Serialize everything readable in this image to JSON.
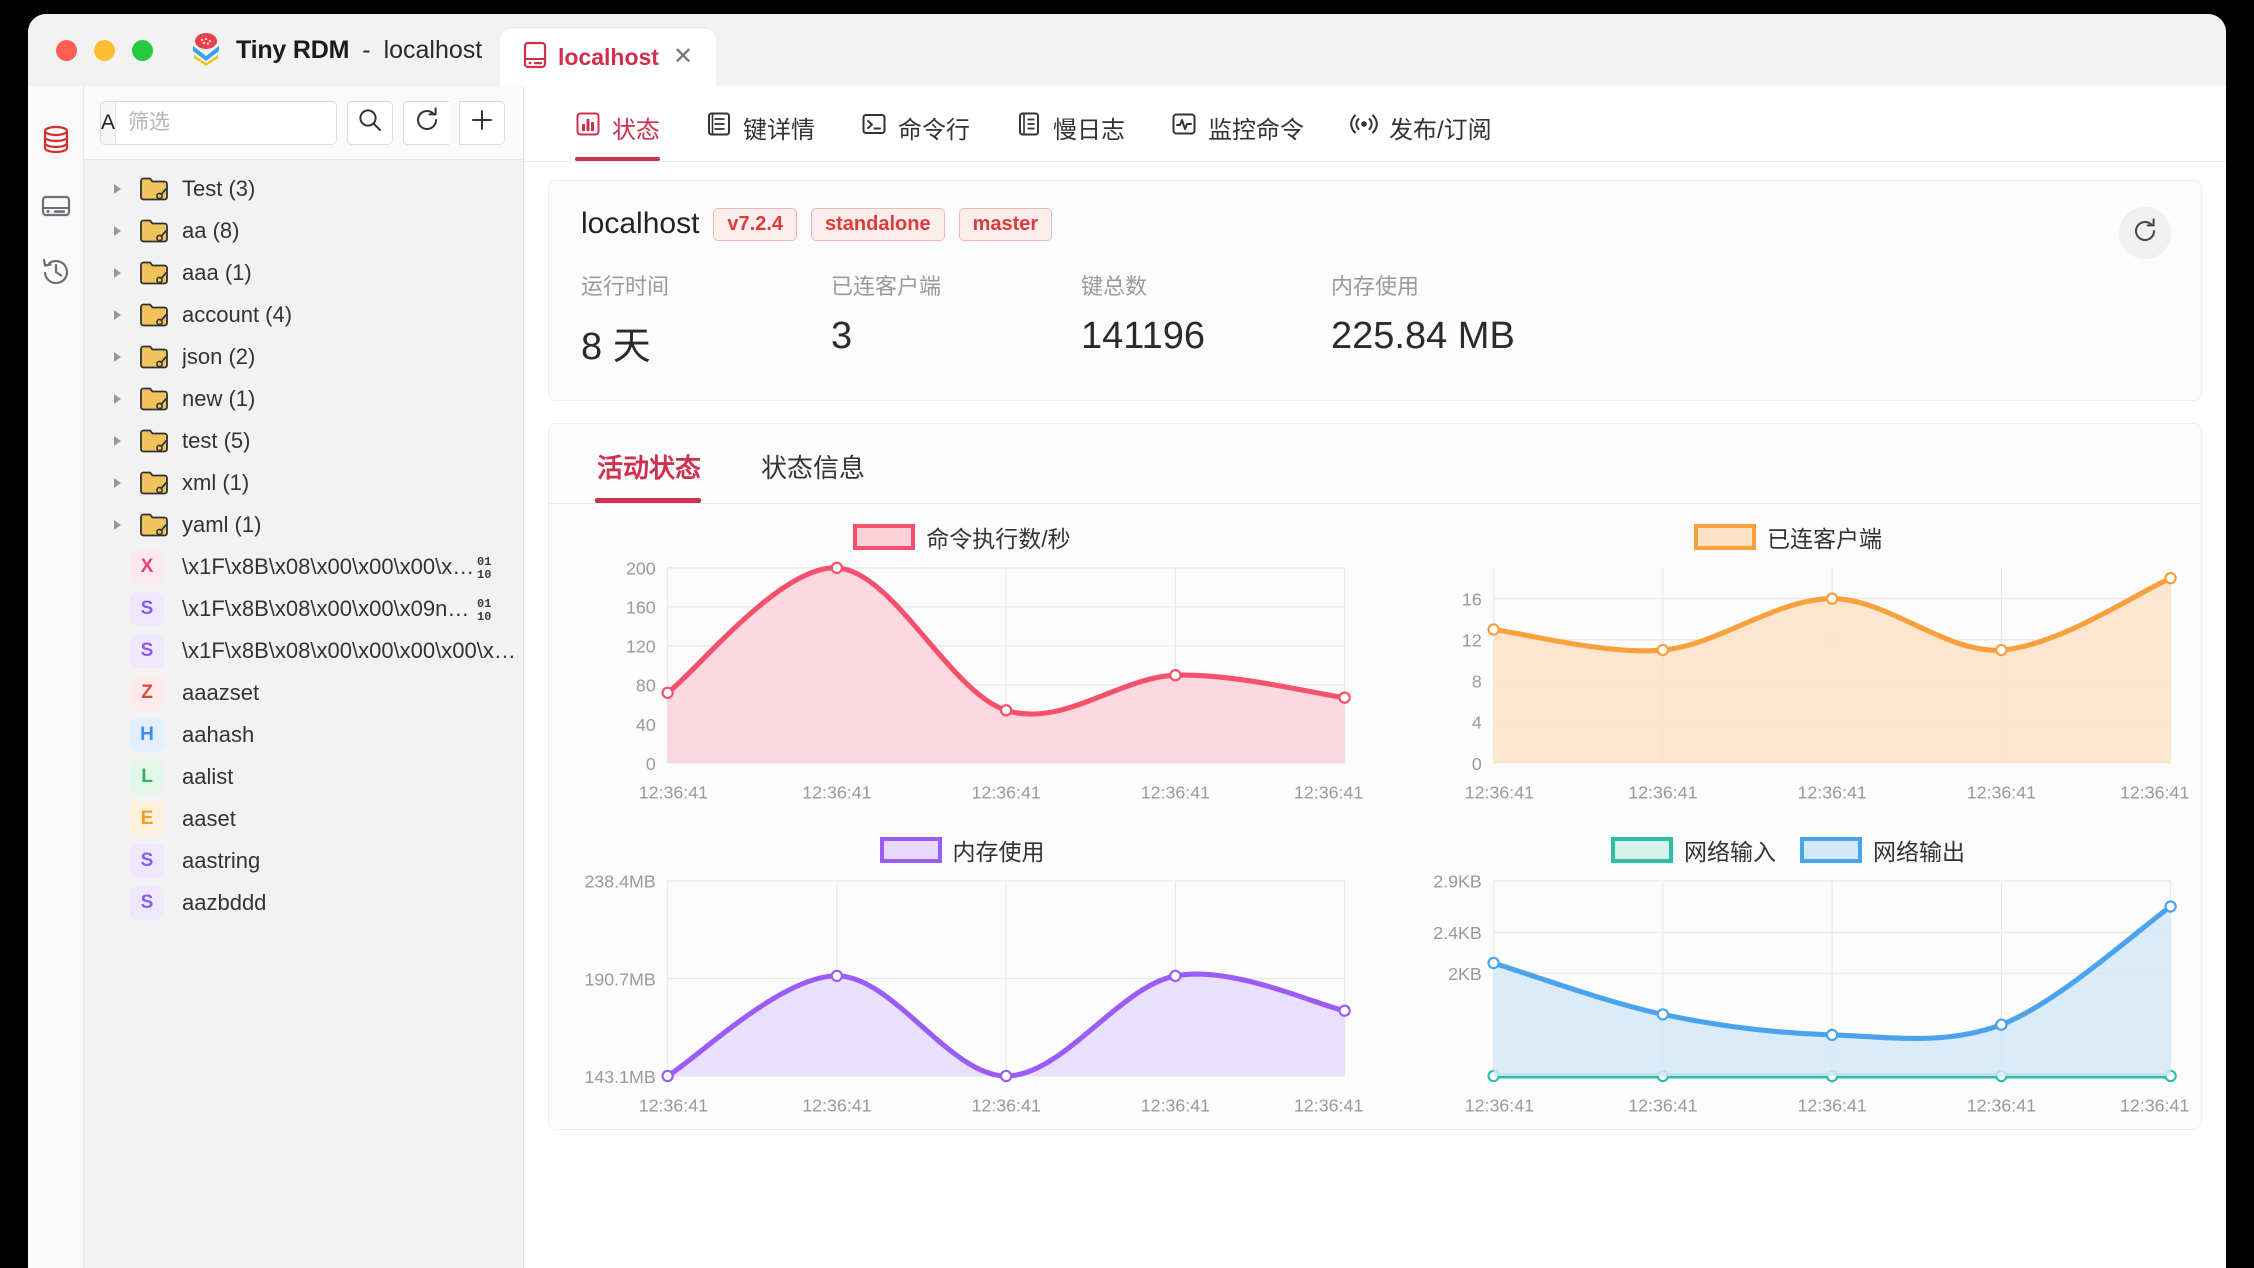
{
  "window": {
    "app_name": "Tiny RDM",
    "title_separator": "-",
    "connection": "localhost",
    "tab_label": "localhost",
    "close_label": "✕"
  },
  "rail": {
    "items": [
      {
        "name": "database-icon",
        "active": true
      },
      {
        "name": "server-icon",
        "active": false
      },
      {
        "name": "history-icon",
        "active": false
      }
    ]
  },
  "sidebar": {
    "filter": {
      "prefix": "A",
      "placeholder": "筛选",
      "value": ""
    },
    "buttons": {
      "search": "search-icon",
      "refresh": "refresh-icon",
      "add": "add-icon"
    },
    "folders": [
      {
        "label": "Test (3)"
      },
      {
        "label": "aa (8)"
      },
      {
        "label": "aaa (1)"
      },
      {
        "label": "account (4)"
      },
      {
        "label": "json (2)"
      },
      {
        "label": "new (1)"
      },
      {
        "label": "test (5)"
      },
      {
        "label": "xml (1)"
      },
      {
        "label": "yaml (1)"
      }
    ],
    "keys": [
      {
        "type": "X",
        "label": "\\x1F\\x8B\\x08\\x00\\x00\\x00\\x0...",
        "binary": true
      },
      {
        "type": "S",
        "label": "\\x1F\\x8B\\x08\\x00\\x00\\x09n\\x8...",
        "binary": true
      },
      {
        "type": "S",
        "label": "\\x1F\\x8B\\x08\\x00\\x00\\x00\\x00\\x0...",
        "binary": false
      },
      {
        "type": "Z",
        "label": "aaazset",
        "binary": false
      },
      {
        "type": "H",
        "label": "aahash",
        "binary": false
      },
      {
        "type": "L",
        "label": "aalist",
        "binary": false
      },
      {
        "type": "E",
        "label": "aaset",
        "binary": false
      },
      {
        "type": "S",
        "label": "aastring",
        "binary": false
      },
      {
        "type": "S",
        "label": "aazbddd",
        "binary": false
      }
    ]
  },
  "main": {
    "tabs": [
      {
        "label": "状态",
        "icon": "status-chart-icon",
        "active": true
      },
      {
        "label": "键详情",
        "icon": "key-detail-icon",
        "active": false
      },
      {
        "label": "命令行",
        "icon": "terminal-icon",
        "active": false
      },
      {
        "label": "慢日志",
        "icon": "slowlog-icon",
        "active": false
      },
      {
        "label": "监控命令",
        "icon": "monitor-icon",
        "active": false
      },
      {
        "label": "发布/订阅",
        "icon": "pubsub-icon",
        "active": false
      }
    ],
    "server": {
      "name": "localhost",
      "tags": [
        "v7.2.4",
        "standalone",
        "master"
      ],
      "refresh_icon": "refresh-icon",
      "stats": [
        {
          "label": "运行时间",
          "value": "8 天"
        },
        {
          "label": "已连客户端",
          "value": "3"
        },
        {
          "label": "键总数",
          "value": "141196"
        },
        {
          "label": "内存使用",
          "value": "225.84 MB"
        }
      ]
    },
    "subtabs": [
      {
        "label": "活动状态",
        "active": true
      },
      {
        "label": "状态信息",
        "active": false
      }
    ]
  },
  "colors": {
    "accent": "#d03050",
    "cmd": "#f5516c",
    "cmd_fill": "#fbd2da",
    "clients": "#f9a03c",
    "clients_fill": "#fbe2c7",
    "memory": "#9b5cf6",
    "memory_fill": "#e5dafd",
    "net_in": "#2bbfa3",
    "net_in_fill": "#d5f2ec",
    "net_out": "#4aa3ec",
    "net_out_fill": "#d3e8f9"
  },
  "chart_data": [
    {
      "type": "area",
      "title": "命令执行数/秒",
      "legend": [
        "命令执行数/秒"
      ],
      "x": [
        "12:36:41",
        "12:36:41",
        "12:36:41",
        "12:36:41",
        "12:36:41"
      ],
      "values": [
        72,
        200,
        54,
        90,
        67
      ],
      "yticks": [
        0,
        40,
        80,
        120,
        160,
        200
      ],
      "yticklabels": [
        "0",
        "40",
        "80",
        "120",
        "160",
        "200"
      ],
      "ylim": [
        0,
        200
      ],
      "grid": true,
      "legend_position": "top"
    },
    {
      "type": "area",
      "title": "已连客户端",
      "legend": [
        "已连客户端"
      ],
      "x": [
        "12:36:41",
        "12:36:41",
        "12:36:41",
        "12:36:41",
        "12:36:41"
      ],
      "values": [
        13,
        11,
        16,
        11,
        18
      ],
      "yticks": [
        0,
        4,
        8,
        12,
        16
      ],
      "yticklabels": [
        "0",
        "4",
        "8",
        "12",
        "16"
      ],
      "ylim": [
        0,
        19
      ],
      "grid": true,
      "legend_position": "top"
    },
    {
      "type": "area",
      "title": "内存使用",
      "legend": [
        "内存使用"
      ],
      "x": [
        "12:36:41",
        "12:36:41",
        "12:36:41",
        "12:36:41",
        "12:36:41"
      ],
      "values": [
        143.1,
        192.0,
        143.1,
        192.0,
        175.0
      ],
      "yticks": [
        143.1,
        190.7,
        238.4
      ],
      "yticklabels": [
        "143.1MB",
        "190.7MB",
        "238.4MB"
      ],
      "ylim": [
        143.1,
        238.4
      ],
      "grid": true,
      "legend_position": "top"
    },
    {
      "type": "area",
      "title": "网络输入/网络输出",
      "legend": [
        "网络输入",
        "网络输出"
      ],
      "x": [
        "12:36:41",
        "12:36:41",
        "12:36:41",
        "12:36:41",
        "12:36:41"
      ],
      "series": [
        {
          "name": "网络输入",
          "values": [
            1.0,
            1.0,
            1.0,
            1.0,
            1.0
          ]
        },
        {
          "name": "网络输出",
          "values": [
            2.1,
            1.6,
            1.4,
            1.5,
            2.65
          ]
        }
      ],
      "yticks": [
        2.0,
        2.4,
        2.9
      ],
      "yticklabels": [
        "2KB",
        "2.4KB",
        "2.9KB"
      ],
      "ylim": [
        1.0,
        2.9
      ],
      "grid": true,
      "legend_position": "top"
    }
  ]
}
